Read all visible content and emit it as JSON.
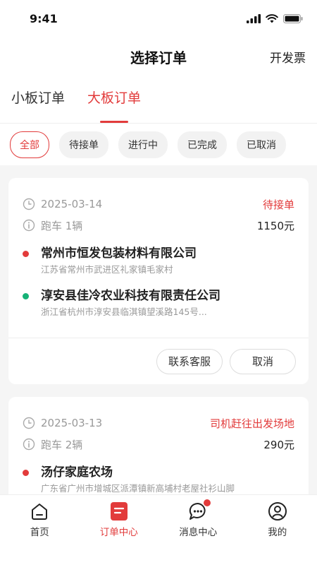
{
  "status_bar": {
    "time": "9:41"
  },
  "nav": {
    "title": "选择订单",
    "action": "开发票"
  },
  "tabs": [
    {
      "label": "小板订单",
      "active": false
    },
    {
      "label": "大板订单",
      "active": true
    }
  ],
  "filters": [
    {
      "label": "全部",
      "active": true
    },
    {
      "label": "待接单",
      "active": false
    },
    {
      "label": "进行中",
      "active": false
    },
    {
      "label": "已完成",
      "active": false
    },
    {
      "label": "已取消",
      "active": false
    }
  ],
  "orders": [
    {
      "date": "2025-03-14",
      "status": "待接单",
      "vehicle": "跑车 1辆",
      "price": "1150元",
      "origin": {
        "name": "常州市恒发包装材料有限公司",
        "address": "江苏省常州市武进区礼家镇毛家村"
      },
      "destination": {
        "name": "淳安县佳冷农业科技有限责任公司",
        "address": "浙江省杭州市淳安县临淇镇望溪路145号..."
      },
      "actions": {
        "contact": "联系客服",
        "cancel": "取消"
      }
    },
    {
      "date": "2025-03-13",
      "status": "司机赶往出发场地",
      "vehicle": "跑车 2辆",
      "price": "290元",
      "origin": {
        "name": "汤仔家庭农场",
        "address": "广东省广州市增城区派潭镇新高埔村老屋社衫山脚"
      }
    }
  ],
  "tabbar": [
    {
      "label": "首页",
      "icon": "home-icon",
      "active": false
    },
    {
      "label": "订单中心",
      "icon": "order-icon",
      "active": true
    },
    {
      "label": "消息中心",
      "icon": "message-icon",
      "active": false,
      "badge": true
    },
    {
      "label": "我的",
      "icon": "user-icon",
      "active": false
    }
  ],
  "colors": {
    "accent": "#e23b3b",
    "destination_dot": "#16b277"
  }
}
